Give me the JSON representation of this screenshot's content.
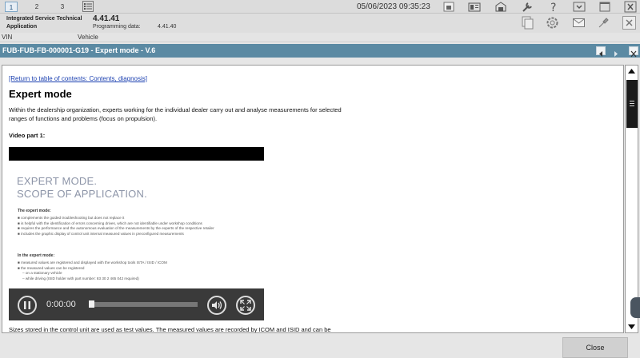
{
  "toolbar": {
    "tabs": [
      "1",
      "2",
      "3"
    ],
    "datetime": "05/06/2023 09:35:23"
  },
  "info": {
    "app_name": "Integrated Service Technical Application",
    "version": "4.41.41",
    "programming_label": "Programming data:",
    "programming_value": "4.41.40"
  },
  "vehicle_row": {
    "vin_label": "VIN",
    "vehicle_label": "Vehicle"
  },
  "document": {
    "title": "FUB-FUB-FB-000001-G19 - Expert mode - V.6",
    "toc_link": "[Return to table of contents: Contents, diagnosis]",
    "heading": "Expert mode",
    "intro": "Within the dealership organization, experts working for the individual dealer carry out and analyse measurements for selected ranges of functions and problems (focus on propulsion).",
    "video_label": "Video part 1:",
    "bottom_text": "Sizes stored in the control unit are used as test values. The measured values are recorded by ICOM and ISID and can be"
  },
  "video": {
    "slide_title_line1": "EXPERT MODE.",
    "slide_title_line2": "SCOPE OF APPLICATION.",
    "section1_heading": "The expert mode:",
    "section1_bullets": [
      "complements the guided troubleshooting but does not replace it",
      "is helpful with the identification of errors concerning drives, which are not identifiable under workshop conditions",
      "requires the performance and the autonomous evaluation of the measurements by the experts of the respective retailer",
      "includes the graphic display of control unit internal measured values in preconfigured measurements"
    ],
    "section2_heading": "In the expert mode:",
    "section2_bullets": [
      "measured values are registered and displayed with the workshop tools ISTA / ISID / ICOM",
      "the measured values can be registered",
      "– on a stationary vehicle",
      "– while driving (ISID holder with part number: 83 30 2 465 042 required)"
    ],
    "time": "0:00:00",
    "progress": 0
  },
  "footer": {
    "close_label": "Close"
  }
}
